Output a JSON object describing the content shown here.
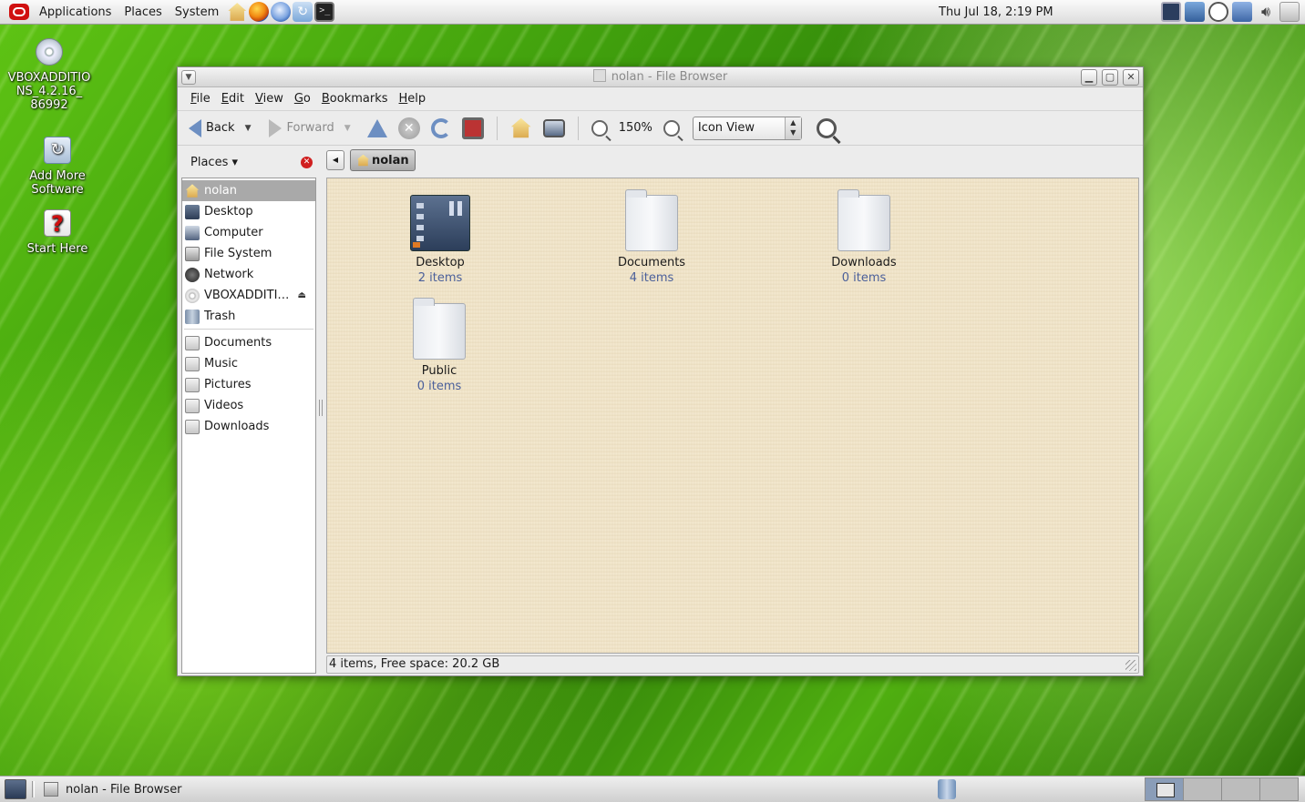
{
  "top_panel": {
    "menus": [
      "Applications",
      "Places",
      "System"
    ],
    "launchers": [
      "home-icon",
      "firefox-icon",
      "thunderbird-icon",
      "software-update-icon",
      "terminal-icon"
    ],
    "clock": "Thu Jul 18,  2:19 PM",
    "tray_icons": [
      "system-monitor-icon",
      "network-manager-icon",
      "clock-icon",
      "accessibility-icon",
      "volume-icon",
      "battery-icon"
    ]
  },
  "desktop_icons": [
    {
      "label": "VBOXADDITIONS_4.2.16_86992",
      "label_lines": [
        "VBOXADDITIO",
        "NS_4.2.16_",
        "86992"
      ],
      "icon": "cd-icon"
    },
    {
      "label": "Add More Software",
      "label_lines": [
        "Add More",
        "Software"
      ],
      "icon": "package-icon"
    },
    {
      "label": "Start Here",
      "label_lines": [
        "Start Here"
      ],
      "icon": "help-icon"
    }
  ],
  "window": {
    "title": "nolan - File Browser",
    "menubar": [
      "File",
      "Edit",
      "View",
      "Go",
      "Bookmarks",
      "Help"
    ],
    "toolbar": {
      "back_label": "Back",
      "forward_label": "Forward",
      "zoom_level": "150%",
      "view_mode": "Icon View"
    },
    "sidebar": {
      "header": "Places",
      "places": [
        {
          "label": "nolan",
          "icon": "home-icon",
          "selected": true
        },
        {
          "label": "Desktop",
          "icon": "desktop-icon"
        },
        {
          "label": "Computer",
          "icon": "computer-icon"
        },
        {
          "label": "File System",
          "icon": "filesystem-icon"
        },
        {
          "label": "Network",
          "icon": "network-icon"
        },
        {
          "label": "VBOXADDITI…",
          "icon": "cd-icon",
          "ejectable": true
        },
        {
          "label": "Trash",
          "icon": "trash-icon"
        }
      ],
      "bookmarks": [
        {
          "label": "Documents",
          "icon": "folder-icon"
        },
        {
          "label": "Music",
          "icon": "folder-icon"
        },
        {
          "label": "Pictures",
          "icon": "folder-icon"
        },
        {
          "label": "Videos",
          "icon": "folder-icon"
        },
        {
          "label": "Downloads",
          "icon": "folder-icon"
        }
      ]
    },
    "pathbar": {
      "current": "nolan"
    },
    "files": [
      {
        "name": "Desktop",
        "info": "2 items",
        "icon": "desktop-folder-icon"
      },
      {
        "name": "Documents",
        "info": "4 items",
        "icon": "folder-icon"
      },
      {
        "name": "Downloads",
        "info": "0 items",
        "icon": "folder-icon"
      },
      {
        "name": "Public",
        "info": "0 items",
        "icon": "folder-icon"
      }
    ],
    "status": "4 items, Free space: 20.2 GB"
  },
  "bottom_panel": {
    "task": "nolan - File Browser",
    "workspaces": 4
  },
  "colors": {
    "accent_blue": "#6d8fc2",
    "file_info": "#4a5f9a",
    "selected_row": "#a9a9a9",
    "icon_area_bg": "#f3e8cf"
  }
}
